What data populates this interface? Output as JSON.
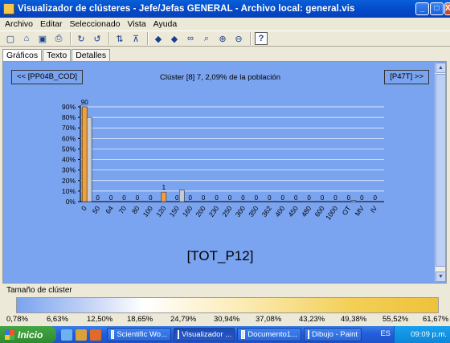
{
  "window": {
    "title": "Visualizador de clústeres - Jefe/Jefas GENERAL - Archivo local: general.vis",
    "minimize": "_",
    "maximize": "□",
    "close": "X"
  },
  "menu": [
    "Archivo",
    "Editar",
    "Seleccionado",
    "Vista",
    "Ayuda"
  ],
  "toolbar_icons": [
    "new-icon",
    "open-icon",
    "save-icon",
    "print-icon",
    "redo-icon",
    "undo-icon",
    "sort-icon",
    "filter-icon",
    "arrow-left-icon",
    "arrow-right-icon",
    "binoculars-icon",
    "find-replace-icon",
    "zoom-in-icon",
    "zoom-out-icon",
    "help-icon"
  ],
  "tabs": [
    "Gráficos",
    "Texto",
    "Detalles"
  ],
  "nav": {
    "prev_label": "<< [PP04B_COD]",
    "next_label": "[P47T] >>",
    "cluster_title": "Clúster [8] 7, 2,09% de la población"
  },
  "variable_label": "[TOT_P12]",
  "legend": {
    "title": "Tamaño de clúster",
    "ticks": [
      "0,78%",
      "6,63%",
      "12,50%",
      "18,65%",
      "24,79%",
      "30,94%",
      "37,08%",
      "43,23%",
      "49,38%",
      "55,52%",
      "61,67%"
    ],
    "colors": {
      "start": "#7aa3f0",
      "mid": "#ffffff",
      "end": "#efc23a"
    }
  },
  "chart_data": {
    "type": "bar",
    "categories": [
      "0",
      "50",
      "64",
      "70",
      "80",
      "100",
      "120",
      "150",
      "160",
      "200",
      "230",
      "250",
      "300",
      "350",
      "362",
      "400",
      "450",
      "480",
      "600",
      "1000",
      "OT",
      "MV",
      "IV"
    ],
    "series": [
      {
        "color": "#f2a03a",
        "values": [
          90,
          0,
          0,
          0,
          0,
          0,
          9,
          0,
          0,
          0,
          0,
          0,
          0,
          0,
          0,
          0,
          0,
          0,
          0,
          0,
          0,
          0,
          0
        ]
      },
      {
        "color": "#c7cbd4",
        "values": [
          80,
          0,
          0,
          0,
          0,
          0,
          0,
          11,
          0,
          0,
          0,
          0,
          0,
          0,
          0,
          0,
          0,
          0,
          0,
          0,
          1,
          0,
          0
        ]
      }
    ],
    "data_labels": {
      "0": "90",
      "120": "1"
    },
    "ylim": [
      0,
      90
    ],
    "yticks": [
      "0%",
      "10%",
      "20%",
      "30%",
      "40%",
      "50%",
      "60%",
      "70%",
      "80%",
      "90%"
    ],
    "grid": true
  },
  "taskbar": {
    "start_label": "Inicio",
    "tasks": [
      "Scientific Wo...",
      "Visualizador ...",
      "Documento1...",
      "Dibujo - Paint"
    ],
    "lang": "ES",
    "clock": "09:09 p.m."
  }
}
